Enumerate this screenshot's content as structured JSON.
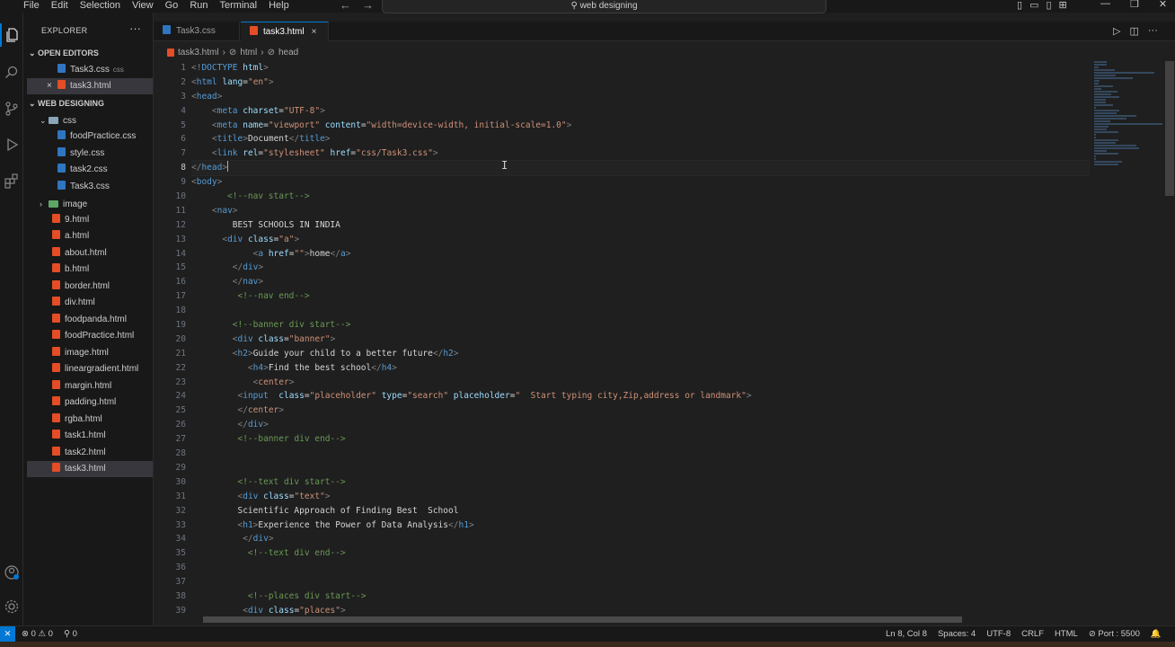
{
  "titlebar": {
    "menu": [
      "File",
      "Edit",
      "Selection",
      "View",
      "Go",
      "Run",
      "Terminal",
      "Help"
    ],
    "search": "web designing"
  },
  "explorer": {
    "title": "EXPLORER",
    "more": "···",
    "open_editors_label": "OPEN EDITORS",
    "open_editors": [
      {
        "name": "Task3.css",
        "hint": "css",
        "icon": "css"
      },
      {
        "name": "task3.html",
        "icon": "html",
        "close": "×"
      }
    ],
    "workspace_label": "WEB DESIGNING",
    "css_folder": "css",
    "css_files": [
      "foodPractice.css",
      "style.css",
      "task2.css",
      "Task3.css"
    ],
    "image_folder": "image",
    "html_files": [
      "9.html",
      "a.html",
      "about.html",
      "b.html",
      "border.html",
      "div.html",
      "foodpanda.html",
      "foodPractice.html",
      "image.html",
      "lineargradient.html",
      "margin.html",
      "padding.html",
      "rgba.html",
      "task1.html",
      "task2.html",
      "task3.html"
    ]
  },
  "tabs": [
    {
      "label": "Task3.css",
      "icon": "css"
    },
    {
      "label": "task3.html",
      "icon": "html",
      "close": "×"
    }
  ],
  "breadcrumb": [
    "task3.html",
    "›",
    "html",
    "›",
    "head"
  ],
  "editor": {
    "current_line": 8,
    "lines": [
      {
        "n": 1,
        "parts": [
          [
            "tk",
            "<!"
          ],
          [
            "tg",
            "DOCTYPE"
          ],
          [
            "at",
            " html"
          ],
          [
            "tk",
            ">"
          ]
        ]
      },
      {
        "n": 2,
        "parts": [
          [
            "tk",
            "<"
          ],
          [
            "tg",
            "html"
          ],
          [
            "at",
            " lang"
          ],
          [
            "tx",
            "="
          ],
          [
            "st",
            "\"en\""
          ],
          [
            "tk",
            ">"
          ]
        ]
      },
      {
        "n": 3,
        "parts": [
          [
            "tk",
            "<"
          ],
          [
            "tg",
            "head"
          ],
          [
            "tk",
            ">"
          ]
        ]
      },
      {
        "n": 4,
        "parts": [
          [
            "tx",
            "    "
          ],
          [
            "tk",
            "<"
          ],
          [
            "tg",
            "meta"
          ],
          [
            "at",
            " charset"
          ],
          [
            "tx",
            "="
          ],
          [
            "st",
            "\"UTF-8\""
          ],
          [
            "tk",
            ">"
          ]
        ]
      },
      {
        "n": 5,
        "parts": [
          [
            "tx",
            "    "
          ],
          [
            "tk",
            "<"
          ],
          [
            "tg",
            "meta"
          ],
          [
            "at",
            " name"
          ],
          [
            "tx",
            "="
          ],
          [
            "st",
            "\"viewport\""
          ],
          [
            "at",
            " content"
          ],
          [
            "tx",
            "="
          ],
          [
            "st",
            "\"width=device-width, initial-scale=1.0\""
          ],
          [
            "tk",
            ">"
          ]
        ]
      },
      {
        "n": 6,
        "parts": [
          [
            "tx",
            "    "
          ],
          [
            "tk",
            "<"
          ],
          [
            "tg",
            "title"
          ],
          [
            "tk",
            ">"
          ],
          [
            "tx",
            "Document"
          ],
          [
            "tk",
            "</"
          ],
          [
            "tg",
            "title"
          ],
          [
            "tk",
            ">"
          ]
        ]
      },
      {
        "n": 7,
        "parts": [
          [
            "tx",
            "    "
          ],
          [
            "tk",
            "<"
          ],
          [
            "tg",
            "link"
          ],
          [
            "at",
            " rel"
          ],
          [
            "tx",
            "="
          ],
          [
            "st",
            "\"stylesheet\""
          ],
          [
            "at",
            " href"
          ],
          [
            "tx",
            "="
          ],
          [
            "st",
            "\"css/Task3.css\""
          ],
          [
            "tk",
            ">"
          ]
        ]
      },
      {
        "n": 8,
        "parts": [
          [
            "tk",
            "</"
          ],
          [
            "tg",
            "head"
          ],
          [
            "tk",
            ">"
          ]
        ],
        "caret": true
      },
      {
        "n": 9,
        "parts": [
          [
            "tk",
            "<"
          ],
          [
            "tg",
            "body"
          ],
          [
            "tk",
            ">"
          ]
        ]
      },
      {
        "n": 10,
        "parts": [
          [
            "tx",
            "       "
          ],
          [
            "cm",
            "<!--nav start-->"
          ]
        ]
      },
      {
        "n": 11,
        "parts": [
          [
            "tx",
            "    "
          ],
          [
            "tk",
            "<"
          ],
          [
            "tg",
            "nav"
          ],
          [
            "tk",
            ">"
          ]
        ]
      },
      {
        "n": 12,
        "parts": [
          [
            "tx",
            "        BEST SCHOOLS IN INDIA"
          ]
        ]
      },
      {
        "n": 13,
        "parts": [
          [
            "tx",
            "      "
          ],
          [
            "tk",
            "<"
          ],
          [
            "tg",
            "div"
          ],
          [
            "at",
            " class"
          ],
          [
            "tx",
            "="
          ],
          [
            "st",
            "\"a\""
          ],
          [
            "tk",
            ">"
          ]
        ]
      },
      {
        "n": 14,
        "parts": [
          [
            "tx",
            "            "
          ],
          [
            "tk",
            "<"
          ],
          [
            "tg",
            "a"
          ],
          [
            "at",
            " href"
          ],
          [
            "tx",
            "="
          ],
          [
            "st",
            "\"\""
          ],
          [
            "tk",
            ">"
          ],
          [
            "tx",
            "home"
          ],
          [
            "tk",
            "</"
          ],
          [
            "tg",
            "a"
          ],
          [
            "tk",
            ">"
          ]
        ]
      },
      {
        "n": 15,
        "parts": [
          [
            "tx",
            "        "
          ],
          [
            "tk",
            "</"
          ],
          [
            "tg",
            "div"
          ],
          [
            "tk",
            ">"
          ]
        ]
      },
      {
        "n": 16,
        "parts": [
          [
            "tx",
            "        "
          ],
          [
            "tk",
            "</"
          ],
          [
            "tg",
            "nav"
          ],
          [
            "tk",
            ">"
          ]
        ]
      },
      {
        "n": 17,
        "parts": [
          [
            "tx",
            "         "
          ],
          [
            "cm",
            "<!--nav end-->"
          ]
        ]
      },
      {
        "n": 18,
        "parts": [
          [
            "tx",
            ""
          ]
        ]
      },
      {
        "n": 19,
        "parts": [
          [
            "tx",
            "        "
          ],
          [
            "cm",
            "<!--banner div start-->"
          ]
        ]
      },
      {
        "n": 20,
        "parts": [
          [
            "tx",
            "        "
          ],
          [
            "tk",
            "<"
          ],
          [
            "tg",
            "div"
          ],
          [
            "at",
            " class"
          ],
          [
            "tx",
            "="
          ],
          [
            "st",
            "\"banner\""
          ],
          [
            "tk",
            ">"
          ]
        ]
      },
      {
        "n": 21,
        "parts": [
          [
            "tx",
            "        "
          ],
          [
            "tk",
            "<"
          ],
          [
            "tg",
            "h2"
          ],
          [
            "tk",
            ">"
          ],
          [
            "tx",
            "Guide your child to a better future"
          ],
          [
            "tk",
            "</"
          ],
          [
            "tg",
            "h2"
          ],
          [
            "tk",
            ">"
          ]
        ]
      },
      {
        "n": 22,
        "parts": [
          [
            "tx",
            "           "
          ],
          [
            "tk",
            "<"
          ],
          [
            "tg",
            "h4"
          ],
          [
            "tk",
            ">"
          ],
          [
            "tx",
            "Find the best school"
          ],
          [
            "tk",
            "</"
          ],
          [
            "tg",
            "h4"
          ],
          [
            "tk",
            ">"
          ]
        ]
      },
      {
        "n": 23,
        "parts": [
          [
            "tx",
            "            "
          ],
          [
            "tk",
            "<"
          ],
          [
            "st",
            "center"
          ],
          [
            "tk",
            ">"
          ]
        ]
      },
      {
        "n": 24,
        "parts": [
          [
            "tx",
            "         "
          ],
          [
            "tk",
            "<"
          ],
          [
            "tg",
            "input"
          ],
          [
            "at",
            "  class"
          ],
          [
            "tx",
            "="
          ],
          [
            "st",
            "\"placeholder\""
          ],
          [
            "at",
            " type"
          ],
          [
            "tx",
            "="
          ],
          [
            "st",
            "\"search\""
          ],
          [
            "at",
            " placeholder"
          ],
          [
            "tx",
            "="
          ],
          [
            "st",
            "\"  Start typing city,Zip,address or landmark\""
          ],
          [
            "tk",
            ">"
          ]
        ]
      },
      {
        "n": 25,
        "parts": [
          [
            "tx",
            "         "
          ],
          [
            "tk",
            "</"
          ],
          [
            "st",
            "center"
          ],
          [
            "tk",
            ">"
          ]
        ]
      },
      {
        "n": 26,
        "parts": [
          [
            "tx",
            "         "
          ],
          [
            "tk",
            "</"
          ],
          [
            "tg",
            "div"
          ],
          [
            "tk",
            ">"
          ]
        ]
      },
      {
        "n": 27,
        "parts": [
          [
            "tx",
            "         "
          ],
          [
            "cm",
            "<!--banner div end-->"
          ]
        ]
      },
      {
        "n": 28,
        "parts": [
          [
            "tx",
            ""
          ]
        ]
      },
      {
        "n": 29,
        "parts": [
          [
            "tx",
            ""
          ]
        ]
      },
      {
        "n": 30,
        "parts": [
          [
            "tx",
            "         "
          ],
          [
            "cm",
            "<!--text div start-->"
          ]
        ]
      },
      {
        "n": 31,
        "parts": [
          [
            "tx",
            "         "
          ],
          [
            "tk",
            "<"
          ],
          [
            "tg",
            "div"
          ],
          [
            "at",
            " class"
          ],
          [
            "tx",
            "="
          ],
          [
            "st",
            "\"text\""
          ],
          [
            "tk",
            ">"
          ]
        ]
      },
      {
        "n": 32,
        "parts": [
          [
            "tx",
            "         Scientific Approach of Finding Best  School"
          ]
        ]
      },
      {
        "n": 33,
        "parts": [
          [
            "tx",
            "         "
          ],
          [
            "tk",
            "<"
          ],
          [
            "tg",
            "h1"
          ],
          [
            "tk",
            ">"
          ],
          [
            "tx",
            "Experience the Power of Data Analysis"
          ],
          [
            "tk",
            "</"
          ],
          [
            "tg",
            "h1"
          ],
          [
            "tk",
            ">"
          ]
        ]
      },
      {
        "n": 34,
        "parts": [
          [
            "tx",
            "          "
          ],
          [
            "tk",
            "</"
          ],
          [
            "tg",
            "div"
          ],
          [
            "tk",
            ">"
          ]
        ]
      },
      {
        "n": 35,
        "parts": [
          [
            "tx",
            "           "
          ],
          [
            "cm",
            "<!--text div end-->"
          ]
        ]
      },
      {
        "n": 36,
        "parts": [
          [
            "tx",
            ""
          ]
        ]
      },
      {
        "n": 37,
        "parts": [
          [
            "tx",
            ""
          ]
        ]
      },
      {
        "n": 38,
        "parts": [
          [
            "tx",
            "           "
          ],
          [
            "cm",
            "<!--places div start-->"
          ]
        ]
      },
      {
        "n": 39,
        "parts": [
          [
            "tx",
            "          "
          ],
          [
            "tk",
            "<"
          ],
          [
            "tg",
            "div"
          ],
          [
            "at",
            " class"
          ],
          [
            "tx",
            "="
          ],
          [
            "st",
            "\"places\""
          ],
          [
            "tk",
            ">"
          ]
        ]
      }
    ]
  },
  "statusbar": {
    "remote": "⨯",
    "errors": "⊗ 0 ⚠ 0",
    "ports": "⚲ 0",
    "position": "Ln 8, Col 8",
    "spaces": "Spaces: 4",
    "encoding": "UTF-8",
    "eol": "CRLF",
    "language": "HTML",
    "port": "⊘ Port : 5500",
    "bell": "🔔"
  },
  "colors": {
    "accent": "#0078d4",
    "html_icon": "#e44d26",
    "css_icon": "#2f75c0",
    "tag": "#569cd6",
    "attr": "#9cdcfe",
    "string": "#ce9178",
    "comment": "#6a9955"
  }
}
